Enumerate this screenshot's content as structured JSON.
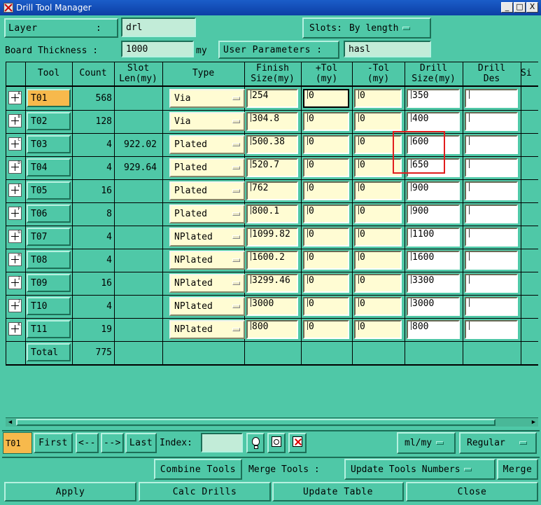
{
  "window": {
    "title": "Drill Tool Manager",
    "minimize_glyph": "_",
    "maximize_glyph": "□",
    "close_glyph": "X"
  },
  "top": {
    "layer_label": "Layer          :",
    "layer_value": "drl",
    "slots_label": "Slots:",
    "slots_value": "By length",
    "thickness_label": "Board Thickness :",
    "thickness_value": "1000",
    "thickness_unit": "my",
    "user_params_label": "User Parameters :",
    "user_params_value": "hasl"
  },
  "table": {
    "headers": {
      "tool": "Tool",
      "count": "Count",
      "slot_len": "Slot\nLen(my)",
      "type": "Type",
      "finish": "Finish\nSize(my)",
      "plus_tol": "+Tol\n(my)",
      "minus_tol": "-Tol\n(my)",
      "drill_size": "Drill\nSize(my)",
      "drill_des": "Drill\nDes",
      "si": "Si"
    },
    "rows": [
      {
        "badge": "A",
        "tool": "T01",
        "count": "568",
        "slot": "",
        "type": "Via",
        "finish": "254",
        "ptol": "0",
        "mtol": "0",
        "drill": "350",
        "des": ""
      },
      {
        "badge": "B",
        "tool": "T02",
        "count": "128",
        "slot": "",
        "type": "Via",
        "finish": "304.8",
        "ptol": "0",
        "mtol": "0",
        "drill": "400",
        "des": ""
      },
      {
        "badge": "C",
        "tool": "T03",
        "count": "4",
        "slot": "922.02",
        "type": "Plated",
        "finish": "500.38",
        "ptol": "0",
        "mtol": "0",
        "drill": "600",
        "des": ""
      },
      {
        "badge": "D",
        "tool": "T04",
        "count": "4",
        "slot": "929.64",
        "type": "Plated",
        "finish": "520.7",
        "ptol": "0",
        "mtol": "0",
        "drill": "650",
        "des": ""
      },
      {
        "badge": "E",
        "tool": "T05",
        "count": "16",
        "slot": "",
        "type": "Plated",
        "finish": "762",
        "ptol": "0",
        "mtol": "0",
        "drill": "900",
        "des": ""
      },
      {
        "badge": "F",
        "tool": "T06",
        "count": "8",
        "slot": "",
        "type": "Plated",
        "finish": "800.1",
        "ptol": "0",
        "mtol": "0",
        "drill": "900",
        "des": ""
      },
      {
        "badge": "G",
        "tool": "T07",
        "count": "4",
        "slot": "",
        "type": "NPlated",
        "finish": "1099.82",
        "ptol": "0",
        "mtol": "0",
        "drill": "1100",
        "des": ""
      },
      {
        "badge": "H",
        "tool": "T08",
        "count": "4",
        "slot": "",
        "type": "NPlated",
        "finish": "1600.2",
        "ptol": "0",
        "mtol": "0",
        "drill": "1600",
        "des": ""
      },
      {
        "badge": "I",
        "tool": "T09",
        "count": "16",
        "slot": "",
        "type": "NPlated",
        "finish": "3299.46",
        "ptol": "0",
        "mtol": "0",
        "drill": "3300",
        "des": ""
      },
      {
        "badge": "J",
        "tool": "T10",
        "count": "4",
        "slot": "",
        "type": "NPlated",
        "finish": "3000",
        "ptol": "0",
        "mtol": "0",
        "drill": "3000",
        "des": ""
      },
      {
        "badge": "K",
        "tool": "T11",
        "count": "19",
        "slot": "",
        "type": "NPlated",
        "finish": "800",
        "ptol": "0",
        "mtol": "0",
        "drill": "800",
        "des": ""
      }
    ],
    "total_label": "Total",
    "total_count": "775"
  },
  "nav": {
    "current_tool": "T01",
    "first": "First",
    "prev": "<--",
    "next": "-->",
    "last": "Last",
    "index_label": "Index:",
    "index_value": "",
    "units_value": "ml/my",
    "mode_value": "Regular"
  },
  "actions": {
    "combine": "Combine Tools",
    "merge_tools": "Merge Tools :",
    "update_numbers": "Update Tools Numbers",
    "merge": "Merge",
    "apply": "Apply",
    "calc": "Calc Drills",
    "update_table": "Update Table",
    "close": "Close"
  },
  "colors": {
    "background": "#4fc8a7",
    "selected_tool": "#f7b94c",
    "highlight": "#e21d1d",
    "cell_bg": "#fffcd3"
  }
}
